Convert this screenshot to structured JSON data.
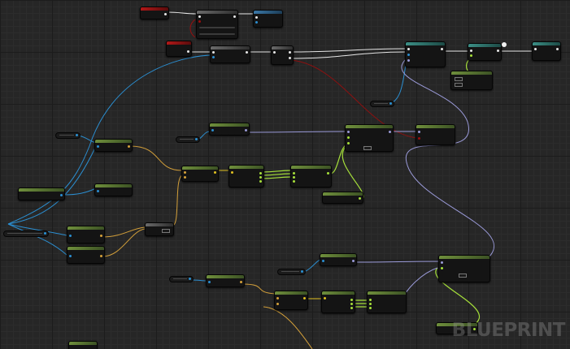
{
  "editor": {
    "watermark": "BLUEPRINT",
    "zoom_level": "unreadable"
  },
  "wire_colors": {
    "exec": "#e6e6e6",
    "object": "#2b8ed0",
    "struct": "#d4a03a",
    "vector": "#e0c020",
    "boolean": "#9a0e0e",
    "rotator": "#9a9ad8",
    "float": "#a6e03a"
  },
  "node_header_colors": {
    "pure_function": "#6f8f3c",
    "event": "#b31818",
    "function_call": "#3a78a8",
    "macro": "#6a6a6a"
  },
  "node_count": 32
}
